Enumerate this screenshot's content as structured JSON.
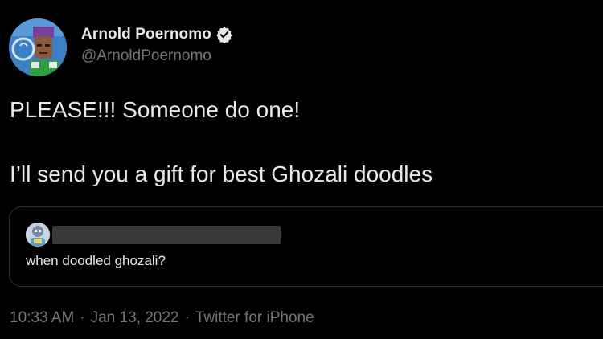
{
  "author": {
    "display_name": "Arnold Poernomo",
    "handle": "@ArnoldPoernomo",
    "verified_icon": "verified-badge-icon"
  },
  "tweet": {
    "line1": "PLEASE!!! Someone do one!",
    "line2": "I’ll send you a gift for best Ghozali doodles"
  },
  "quoted_tweet": {
    "text": "when doodled ghozali?"
  },
  "meta": {
    "time": "10:33 AM",
    "separator": "·",
    "date": "Jan 13, 2022",
    "source": "Twitter for iPhone"
  },
  "colors": {
    "background": "#000000",
    "primary_text": "#e7e9ea",
    "secondary_text": "#71767b",
    "border": "#2f3336"
  }
}
